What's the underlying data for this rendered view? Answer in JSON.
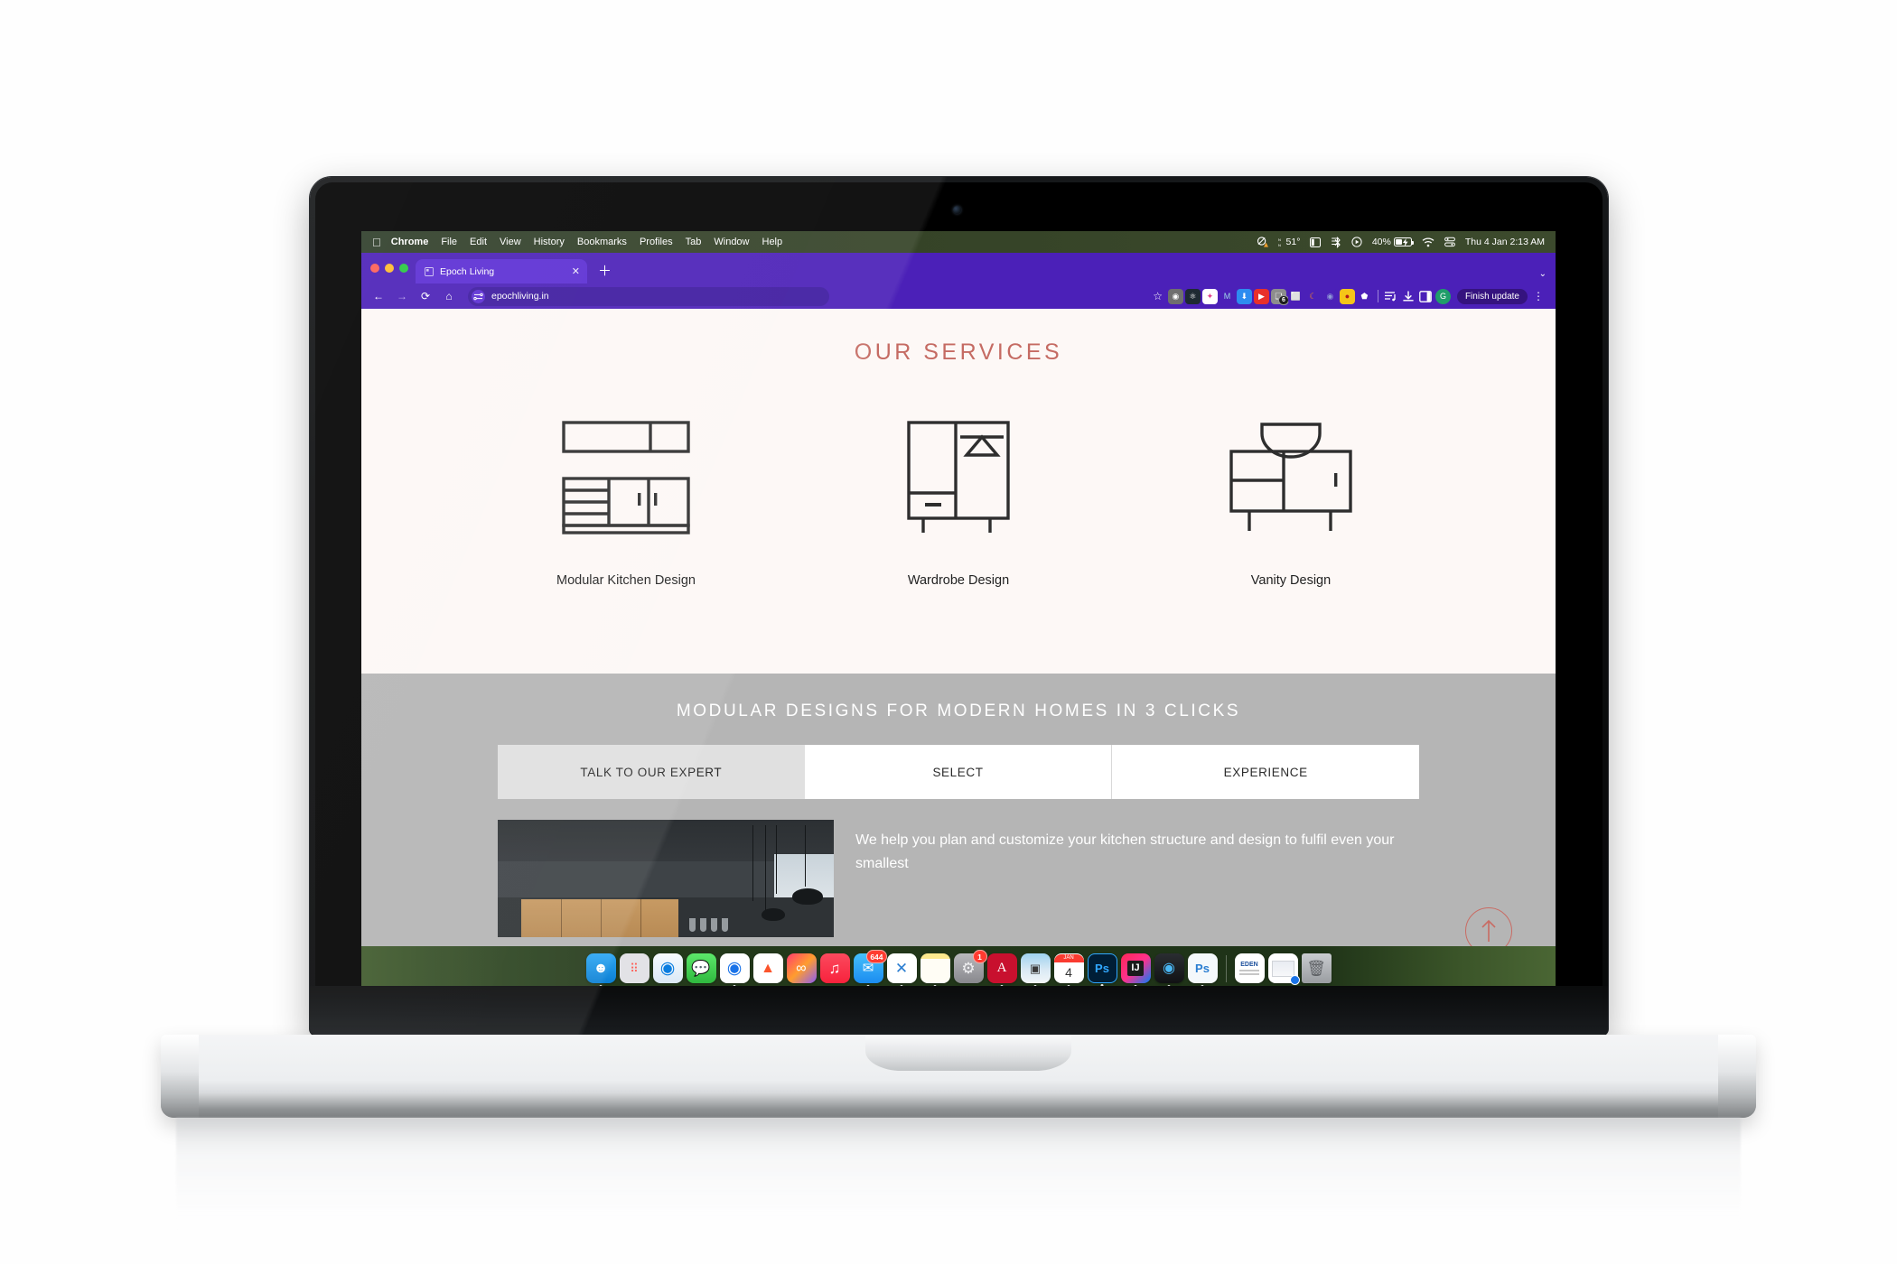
{
  "menubar": {
    "apple_icon": "apple-logo",
    "items": [
      {
        "label": "Chrome",
        "bold": true
      },
      {
        "label": "File",
        "bold": false
      },
      {
        "label": "Edit",
        "bold": false
      },
      {
        "label": "View",
        "bold": false
      },
      {
        "label": "History",
        "bold": false
      },
      {
        "label": "Bookmarks",
        "bold": false
      },
      {
        "label": "Profiles",
        "bold": false
      },
      {
        "label": "Tab",
        "bold": false
      },
      {
        "label": "Window",
        "bold": false
      },
      {
        "label": "Help",
        "bold": false
      }
    ],
    "status": {
      "screen_mirror_icon": "screen-mirroring-warning-icon",
      "weather_icon": "weather-icon",
      "temperature": "51°",
      "stage_manager_icon": "stage-manager-icon",
      "bluetooth_icon": "bluetooth-icon",
      "focus_icon": "focus-play-icon",
      "battery_percent": "40%",
      "battery_icon": "battery-charging-icon",
      "wifi_icon": "wifi-icon",
      "control_center_icon": "control-center-icon",
      "datetime": "Thu 4 Jan  2:13 AM"
    }
  },
  "browser": {
    "window_controls": [
      "close",
      "minimize",
      "maximize"
    ],
    "tab": {
      "title": "Epoch Living",
      "favicon": "epoch-favicon",
      "close_label": "✕"
    },
    "new_tab_label": "＋",
    "tabstrip_caret": "⌄",
    "toolbar": {
      "back_label": "←",
      "forward_label": "→",
      "reload_label": "⟳",
      "home_label": "⌂",
      "site_info_icon": "site-settings-icon",
      "url": "epochliving.in",
      "bookmark_icon": "star-icon",
      "extensions": [
        {
          "name": "screenshot-ext",
          "color": "#6b6b6b",
          "glyph": "◉"
        },
        {
          "name": "react-devtools-ext",
          "color": "#1e2a33",
          "glyph": "⚛"
        },
        {
          "name": "color-picker-ext",
          "color": "#ffffff",
          "glyph": "✦"
        },
        {
          "name": "grammar-ext",
          "color": "#4b20b8",
          "glyph": "M"
        },
        {
          "name": "downloader-ext",
          "color": "#2d8cf0",
          "glyph": "⬇"
        },
        {
          "name": "video-ext",
          "color": "#e8302a",
          "glyph": "▸"
        },
        {
          "name": "clipboard-ext",
          "color": "#6e6e6e",
          "glyph": "❏"
        },
        {
          "name": "capture-ext",
          "color": "#4b20b8",
          "glyph": "⬚"
        },
        {
          "name": "moon-ext",
          "color": "#f0712a",
          "glyph": "☾"
        },
        {
          "name": "globe-ext",
          "color": "#6f7cc4",
          "glyph": "◍"
        },
        {
          "name": "tiger-ext",
          "color": "#f5c518",
          "glyph": "⬤"
        },
        {
          "name": "ghost-ext",
          "color": "#4b20b8",
          "glyph": "⬠"
        }
      ],
      "reading_list_icon": "reading-list-icon",
      "downloads_icon": "downloads-icon",
      "side_panel_icon": "side-panel-icon",
      "profile_initial": "G",
      "update_button": "Finish update",
      "menu_icon": "kebab-menu-icon"
    }
  },
  "page": {
    "services": {
      "heading": "OUR SERVICES",
      "cards": [
        {
          "label": "Modular Kitchen Design",
          "icon": "modular-kitchen-icon"
        },
        {
          "label": "Wardrobe Design",
          "icon": "wardrobe-icon"
        },
        {
          "label": "Vanity Design",
          "icon": "vanity-icon"
        }
      ]
    },
    "banner": {
      "heading": "MODULAR DESIGNS FOR MODERN HOMES IN 3 CLICKS",
      "tabs": [
        {
          "label": "TALK TO OUR EXPERT",
          "active": true
        },
        {
          "label": "SELECT",
          "active": false
        },
        {
          "label": "EXPERIENCE",
          "active": false
        }
      ],
      "promo_text": "We help you plan and customize your kitchen structure and design to fulfil even your smallest",
      "promo_image_alt": "dark-modern-kitchen-photo"
    },
    "scroll_top": {
      "icon": "arrow-up-icon",
      "color": "#c96b63"
    },
    "colors": {
      "page_bg": "#fdf8f6",
      "accent": "#c56b63",
      "banner_bg": "#b5b5b5",
      "tab_active_bg": "#e0e0e0"
    }
  },
  "dock": {
    "items": [
      {
        "name": "finder",
        "glyph": "☺",
        "color": "#1f9cf0",
        "badge": null,
        "running": true
      },
      {
        "name": "launchpad",
        "glyph": "⠿",
        "color": "#d8d8dc",
        "badge": null,
        "running": false
      },
      {
        "name": "safari",
        "glyph": "◎",
        "color": "#f2f6fa",
        "badge": null,
        "running": false
      },
      {
        "name": "messages",
        "glyph": "💬",
        "color": "#4cd964",
        "badge": null,
        "running": false
      },
      {
        "name": "chrome",
        "glyph": "◉",
        "color": "#ffffff",
        "badge": null,
        "running": true
      },
      {
        "name": "brave",
        "glyph": "🦁",
        "color": "#ffffff",
        "badge": null,
        "running": false
      },
      {
        "name": "creative-cloud",
        "glyph": "∞",
        "color": "#e8408a",
        "badge": null,
        "running": false
      },
      {
        "name": "music",
        "glyph": "♫",
        "color": "#fa2d48",
        "badge": null,
        "running": false
      },
      {
        "name": "mail",
        "glyph": "✉",
        "color": "#1f9cf0",
        "badge": "644",
        "running": true
      },
      {
        "name": "vs-code",
        "glyph": "✕",
        "color": "#ffffff",
        "badge": null,
        "running": true
      },
      {
        "name": "notes",
        "glyph": "▤",
        "color": "#fdf3c6",
        "badge": null,
        "running": true
      },
      {
        "name": "system-settings",
        "glyph": "⚙",
        "color": "#9a9a9e",
        "badge": "1",
        "running": false
      },
      {
        "name": "acrobat-reader",
        "glyph": "A",
        "color": "#c8102e",
        "badge": null,
        "running": true
      },
      {
        "name": "preview",
        "glyph": "▣",
        "color": "#eef3f7",
        "badge": null,
        "running": true
      },
      {
        "name": "calendar",
        "glyph": "4",
        "color": "#ffffff",
        "badge": null,
        "running": true
      },
      {
        "name": "photoshop",
        "glyph": "Ps",
        "color": "#001e36",
        "badge": null,
        "running": true
      },
      {
        "name": "intellij-idea",
        "glyph": "IJ",
        "color": "#1b1b1b",
        "badge": null,
        "running": true
      },
      {
        "name": "quicktime",
        "glyph": "▶",
        "color": "#111214",
        "badge": null,
        "running": true
      },
      {
        "name": "photoshop-2",
        "glyph": "Ps",
        "color": "#f4f8fb",
        "badge": null,
        "running": true
      }
    ],
    "files": [
      {
        "name": "eden-document",
        "label": "EDEN"
      },
      {
        "name": "screenshot-file",
        "label": ""
      }
    ],
    "trash": {
      "name": "trash",
      "glyph": "🗑"
    },
    "calendar_month": "JAN"
  }
}
